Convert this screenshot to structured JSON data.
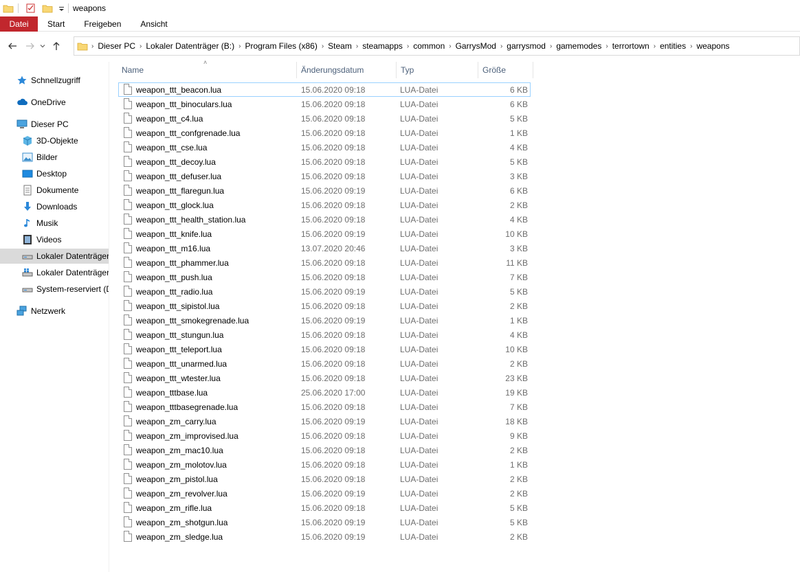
{
  "window": {
    "title": "weapons"
  },
  "ribbon": {
    "tabs": [
      "Datei",
      "Start",
      "Freigeben",
      "Ansicht"
    ]
  },
  "breadcrumb": [
    "Dieser PC",
    "Lokaler Datenträger (B:)",
    "Program Files (x86)",
    "Steam",
    "steamapps",
    "common",
    "GarrysMod",
    "garrysmod",
    "gamemodes",
    "terrortown",
    "entities",
    "weapons"
  ],
  "sidebar": {
    "items": [
      {
        "label": "Schnellzugriff",
        "icon": "star-icon"
      },
      {
        "label": "OneDrive",
        "icon": "cloud-icon"
      },
      {
        "label": "Dieser PC",
        "icon": "computer-icon"
      },
      {
        "label": "3D-Objekte",
        "icon": "cube-icon"
      },
      {
        "label": "Bilder",
        "icon": "pictures-icon"
      },
      {
        "label": "Desktop",
        "icon": "desktop-icon"
      },
      {
        "label": "Dokumente",
        "icon": "documents-icon"
      },
      {
        "label": "Downloads",
        "icon": "download-icon"
      },
      {
        "label": "Musik",
        "icon": "music-icon"
      },
      {
        "label": "Videos",
        "icon": "video-icon"
      },
      {
        "label": "Lokaler Datenträger",
        "icon": "drive-icon"
      },
      {
        "label": "Lokaler Datenträger",
        "icon": "windows-drive-icon"
      },
      {
        "label": "System-reserviert (D",
        "icon": "drive-icon"
      },
      {
        "label": "Netzwerk",
        "icon": "network-icon"
      }
    ]
  },
  "columns": {
    "name": "Name",
    "date": "Änderungsdatum",
    "type": "Typ",
    "size": "Größe"
  },
  "files": [
    {
      "name": "weapon_ttt_beacon.lua",
      "date": "15.06.2020 09:18",
      "type": "LUA-Datei",
      "size": "6 KB"
    },
    {
      "name": "weapon_ttt_binoculars.lua",
      "date": "15.06.2020 09:18",
      "type": "LUA-Datei",
      "size": "6 KB"
    },
    {
      "name": "weapon_ttt_c4.lua",
      "date": "15.06.2020 09:18",
      "type": "LUA-Datei",
      "size": "5 KB"
    },
    {
      "name": "weapon_ttt_confgrenade.lua",
      "date": "15.06.2020 09:18",
      "type": "LUA-Datei",
      "size": "1 KB"
    },
    {
      "name": "weapon_ttt_cse.lua",
      "date": "15.06.2020 09:18",
      "type": "LUA-Datei",
      "size": "4 KB"
    },
    {
      "name": "weapon_ttt_decoy.lua",
      "date": "15.06.2020 09:18",
      "type": "LUA-Datei",
      "size": "5 KB"
    },
    {
      "name": "weapon_ttt_defuser.lua",
      "date": "15.06.2020 09:18",
      "type": "LUA-Datei",
      "size": "3 KB"
    },
    {
      "name": "weapon_ttt_flaregun.lua",
      "date": "15.06.2020 09:19",
      "type": "LUA-Datei",
      "size": "6 KB"
    },
    {
      "name": "weapon_ttt_glock.lua",
      "date": "15.06.2020 09:18",
      "type": "LUA-Datei",
      "size": "2 KB"
    },
    {
      "name": "weapon_ttt_health_station.lua",
      "date": "15.06.2020 09:18",
      "type": "LUA-Datei",
      "size": "4 KB"
    },
    {
      "name": "weapon_ttt_knife.lua",
      "date": "15.06.2020 09:19",
      "type": "LUA-Datei",
      "size": "10 KB"
    },
    {
      "name": "weapon_ttt_m16.lua",
      "date": "13.07.2020 20:46",
      "type": "LUA-Datei",
      "size": "3 KB"
    },
    {
      "name": "weapon_ttt_phammer.lua",
      "date": "15.06.2020 09:18",
      "type": "LUA-Datei",
      "size": "11 KB"
    },
    {
      "name": "weapon_ttt_push.lua",
      "date": "15.06.2020 09:18",
      "type": "LUA-Datei",
      "size": "7 KB"
    },
    {
      "name": "weapon_ttt_radio.lua",
      "date": "15.06.2020 09:19",
      "type": "LUA-Datei",
      "size": "5 KB"
    },
    {
      "name": "weapon_ttt_sipistol.lua",
      "date": "15.06.2020 09:18",
      "type": "LUA-Datei",
      "size": "2 KB"
    },
    {
      "name": "weapon_ttt_smokegrenade.lua",
      "date": "15.06.2020 09:19",
      "type": "LUA-Datei",
      "size": "1 KB"
    },
    {
      "name": "weapon_ttt_stungun.lua",
      "date": "15.06.2020 09:18",
      "type": "LUA-Datei",
      "size": "4 KB"
    },
    {
      "name": "weapon_ttt_teleport.lua",
      "date": "15.06.2020 09:18",
      "type": "LUA-Datei",
      "size": "10 KB"
    },
    {
      "name": "weapon_ttt_unarmed.lua",
      "date": "15.06.2020 09:18",
      "type": "LUA-Datei",
      "size": "2 KB"
    },
    {
      "name": "weapon_ttt_wtester.lua",
      "date": "15.06.2020 09:18",
      "type": "LUA-Datei",
      "size": "23 KB"
    },
    {
      "name": "weapon_tttbase.lua",
      "date": "25.06.2020 17:00",
      "type": "LUA-Datei",
      "size": "19 KB"
    },
    {
      "name": "weapon_tttbasegrenade.lua",
      "date": "15.06.2020 09:18",
      "type": "LUA-Datei",
      "size": "7 KB"
    },
    {
      "name": "weapon_zm_carry.lua",
      "date": "15.06.2020 09:19",
      "type": "LUA-Datei",
      "size": "18 KB"
    },
    {
      "name": "weapon_zm_improvised.lua",
      "date": "15.06.2020 09:18",
      "type": "LUA-Datei",
      "size": "9 KB"
    },
    {
      "name": "weapon_zm_mac10.lua",
      "date": "15.06.2020 09:18",
      "type": "LUA-Datei",
      "size": "2 KB"
    },
    {
      "name": "weapon_zm_molotov.lua",
      "date": "15.06.2020 09:18",
      "type": "LUA-Datei",
      "size": "1 KB"
    },
    {
      "name": "weapon_zm_pistol.lua",
      "date": "15.06.2020 09:18",
      "type": "LUA-Datei",
      "size": "2 KB"
    },
    {
      "name": "weapon_zm_revolver.lua",
      "date": "15.06.2020 09:19",
      "type": "LUA-Datei",
      "size": "2 KB"
    },
    {
      "name": "weapon_zm_rifle.lua",
      "date": "15.06.2020 09:18",
      "type": "LUA-Datei",
      "size": "5 KB"
    },
    {
      "name": "weapon_zm_shotgun.lua",
      "date": "15.06.2020 09:19",
      "type": "LUA-Datei",
      "size": "5 KB"
    },
    {
      "name": "weapon_zm_sledge.lua",
      "date": "15.06.2020 09:19",
      "type": "LUA-Datei",
      "size": "2 KB"
    }
  ],
  "colors": {
    "file_tab": "#c1272d",
    "header_text": "#4c607a",
    "focus_outline": "#99d1ff",
    "selected_sidebar": "#dadada"
  }
}
